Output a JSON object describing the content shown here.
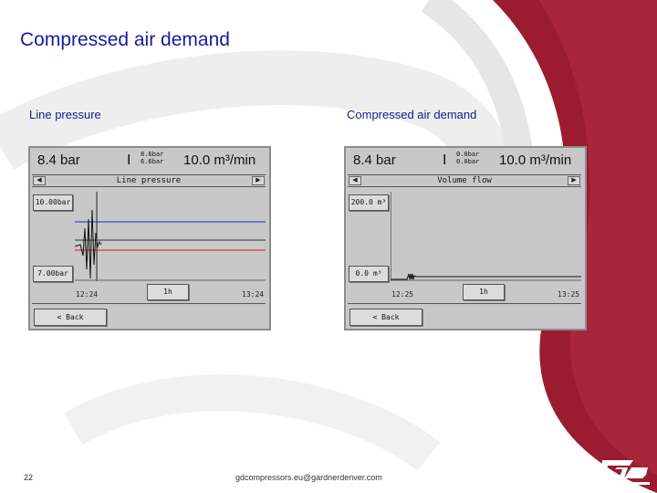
{
  "slide": {
    "title": "Compressed air demand",
    "page_number": "22",
    "footer_email": "gdcompressors.eu@gardnerdenver.com",
    "brand_color": "#9b1b30"
  },
  "left_panel": {
    "caption": "Line pressure",
    "readout_pressure": "8.4 bar",
    "limit_high": "8.6bar",
    "limit_low": "6.6bar",
    "readout_flow": "10.0 m³/min",
    "screen_title": "Line pressure",
    "axis_max": "10.00bar",
    "axis_min": "7.00bar",
    "time_start": "12:24",
    "time_end": "13:24",
    "range_button": "1h",
    "back_button": "< Back",
    "colors": {
      "upper_limit": "#1a2ad0",
      "lower_limit": "#d01a1a",
      "trace": "#111111"
    }
  },
  "right_panel": {
    "caption": "Compressed air demand",
    "readout_pressure": "8.4 bar",
    "limit_high": "0.0bar",
    "limit_low": "0.0bar",
    "readout_flow": "10.0 m³/min",
    "screen_title": "Volume flow",
    "axis_max": "200.0 m³",
    "axis_min": "0.0 m³",
    "time_start": "12:25",
    "time_end": "13:25",
    "range_button": "1h",
    "back_button": "< Back"
  }
}
